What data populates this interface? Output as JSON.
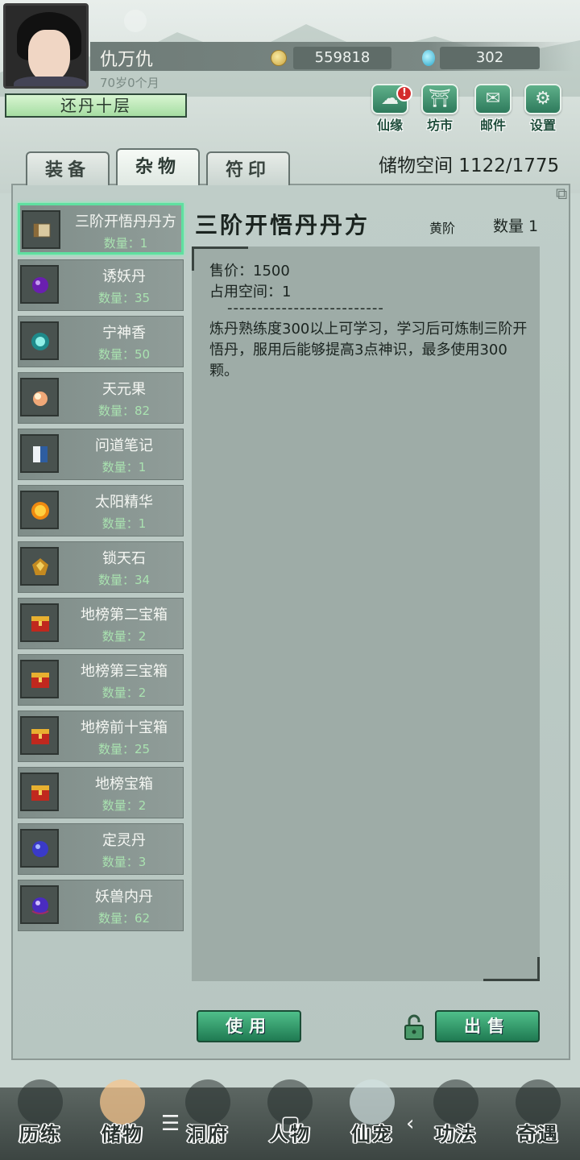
{
  "header": {
    "player_name": "仇万仇",
    "age": "70岁0个月",
    "coins": "559818",
    "gems": "302",
    "realm": "还丹十层",
    "buttons": [
      {
        "label": "仙缘",
        "icon": "cloud-icon",
        "badge": "!"
      },
      {
        "label": "坊市",
        "icon": "pavilion-icon"
      },
      {
        "label": "邮件",
        "icon": "mail-icon"
      },
      {
        "label": "设置",
        "icon": "gear-icon"
      }
    ]
  },
  "tabs": [
    "装备",
    "杂物",
    "符印"
  ],
  "active_tab": "杂物",
  "storage": "储物空间  1122/1775",
  "qty_prefix": "数量：",
  "items": [
    {
      "name": "三阶开悟丹丹方",
      "qty": "数量：1",
      "icon": "scroll-icon"
    },
    {
      "name": "诱妖丹",
      "qty": "数量：35",
      "icon": "purple-pill-icon"
    },
    {
      "name": "宁神香",
      "qty": "数量：50",
      "icon": "incense-icon"
    },
    {
      "name": "天元果",
      "qty": "数量：82",
      "icon": "fruit-icon"
    },
    {
      "name": "问道笔记",
      "qty": "数量：1",
      "icon": "book-icon"
    },
    {
      "name": "太阳精华",
      "qty": "数量：1",
      "icon": "sun-orb-icon"
    },
    {
      "name": "锁天石",
      "qty": "数量：34",
      "icon": "stone-icon"
    },
    {
      "name": "地榜第二宝箱",
      "qty": "数量：2",
      "icon": "treasure-chest-icon"
    },
    {
      "name": "地榜第三宝箱",
      "qty": "数量：2",
      "icon": "treasure-chest-icon"
    },
    {
      "name": "地榜前十宝箱",
      "qty": "数量：25",
      "icon": "treasure-chest-icon"
    },
    {
      "name": "地榜宝箱",
      "qty": "数量：2",
      "icon": "treasure-chest-icon"
    },
    {
      "name": "定灵丹",
      "qty": "数量：3",
      "icon": "blue-pill-icon"
    },
    {
      "name": "妖兽内丹",
      "qty": "数量：62",
      "icon": "beast-core-icon"
    }
  ],
  "detail": {
    "title": "三阶开悟丹丹方",
    "grade": "黄阶",
    "qty": "数量 1",
    "price": "售价：1500",
    "space": "占用空间：1",
    "divider": "--------------------------",
    "description": "炼丹熟练度300以上可学习，学习后可炼制三阶开悟丹，服用后能够提高3点神识，最多使用300颗。"
  },
  "actions": {
    "use": "使用",
    "sell": "出售"
  },
  "bottom_nav": [
    "历练",
    "储物",
    "洞府",
    "人物",
    "仙宠",
    "功法",
    "奇遇"
  ],
  "system_nav": {
    "menu": "☰",
    "home": "▢",
    "back": "‹"
  },
  "colors": {
    "accent": "#2e7a5c",
    "selected_border": "#5fe0a0",
    "qty_text": "#a9e2b0"
  }
}
